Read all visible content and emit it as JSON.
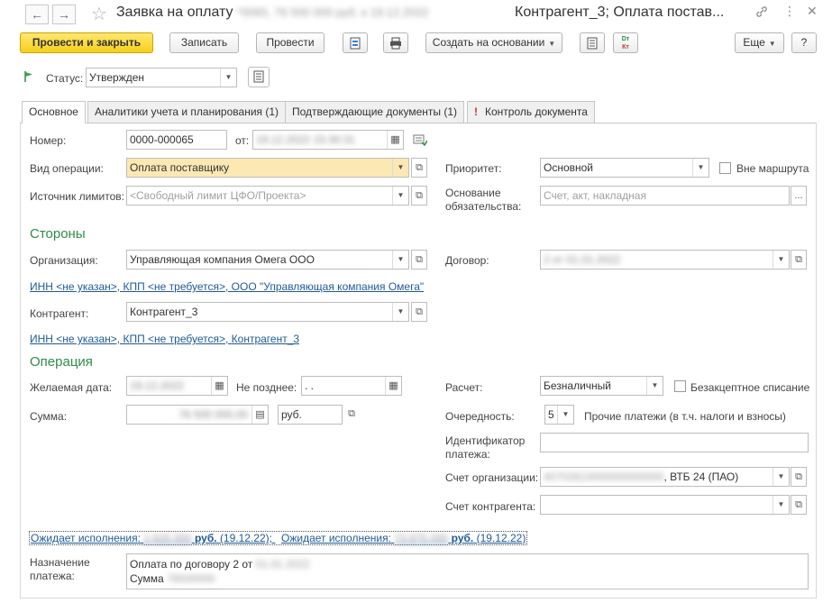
{
  "window": {
    "title": "Заявка на оплату",
    "title_blurred": "*0065, 76 500 000 руб. к 19.12.2022",
    "title_suffix": "Контрагент_3; Оплата постав..."
  },
  "toolbar": {
    "post_close": "Провести и закрыть",
    "save": "Записать",
    "post": "Провести",
    "create_based": "Создать на основании",
    "more": "Еще",
    "help": "?"
  },
  "status": {
    "label": "Статус:",
    "value": "Утвержден"
  },
  "tabs": [
    {
      "label": "Основное"
    },
    {
      "label": "Аналитики учета и планирования (1)"
    },
    {
      "label": "Подтверждающие документы (1)"
    },
    {
      "label": "Контроль документа"
    }
  ],
  "form": {
    "number_label": "Номер:",
    "number": "0000-000065",
    "date_label": "от:",
    "date": "19.12.2022 15:30:31",
    "op_type_label": "Вид операции:",
    "op_type": "Оплата поставщику",
    "priority_label": "Приоритет:",
    "priority": "Основной",
    "out_of_route": "Вне маршрута",
    "limit_source_label": "Источник лимитов:",
    "limit_source_placeholder": "<Свободный лимит ЦФО/Проекта>",
    "basis_label_1": "Основание",
    "basis_label_2": "обязательства:",
    "basis_placeholder": "Счет, акт, накладная",
    "parties_section": "Стороны",
    "org_label": "Организация:",
    "org": "Управляющая компания Омега ООО",
    "contract_label": "Договор:",
    "contract": "2 от 01.01.2022",
    "org_link": "ИНН <не указан>, КПП <не требуется>, ООО \"Управляющая компания Омега\"",
    "counterparty_label": "Контрагент:",
    "counterparty": "Контрагент_3",
    "counterparty_link": "ИНН <не указан>, КПП <не требуется>, Контрагент_3",
    "operation_section": "Операция",
    "desired_date_label": "Желаемая дата:",
    "desired_date": "19.12.2022",
    "not_later_label": "Не позднее:",
    "not_later": " .  .",
    "settlement_label": "Расчет:",
    "settlement": "Безналичный",
    "noncash_writeoff": "Безакцептное списание",
    "amount_label": "Сумма:",
    "amount": "76 500 000,00",
    "currency": "руб.",
    "queue_label": "Очередность:",
    "queue": "5",
    "queue_desc": "Прочие платежи (в т.ч. налоги и взносы)",
    "payment_id_label_1": "Идентификатор",
    "payment_id_label_2": "платежа:",
    "org_account_label": "Счет организации:",
    "org_account_blur": "40702810000000000000",
    "org_account_bank": ", ВТБ 24 (ПАО)",
    "cp_account_label": "Счет контрагента:",
    "awaiting_1_prefix": "Ожидает исполнения:",
    "awaiting_1_blur": "2 625 000",
    "awaiting_1_cur": "руб.",
    "awaiting_1_date": "(19.12.22);",
    "awaiting_2_prefix": "Ожидает исполнения:",
    "awaiting_2_blur": "73 875 000",
    "awaiting_2_cur": "руб.",
    "awaiting_2_date": "(19.12.22)",
    "purpose_label_1": "Назначение",
    "purpose_label_2": "платежа:",
    "purpose_line1": "Оплата по договору 2 от",
    "purpose_line1_blur": "01.01.2022",
    "purpose_line2": "Сумма",
    "purpose_line2_blur": "76500000"
  },
  "colors": {
    "accent_green": "#2e8c46",
    "link_blue": "#1f5a94",
    "primary_yellow": "#f6cf1a",
    "highlight": "#fbe8b3"
  }
}
